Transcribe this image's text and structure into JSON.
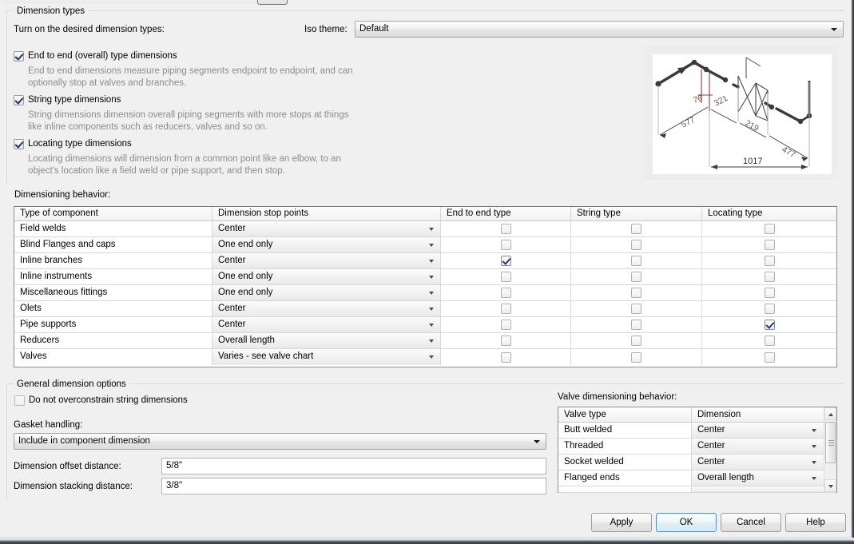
{
  "dimension_types": {
    "group_label": "Dimension types",
    "instruction": "Turn on the desired dimension types:",
    "iso_theme_label": "Iso theme:",
    "iso_theme_value": "Default",
    "options": [
      {
        "label": "End to end (overall) type dimensions",
        "checked": true,
        "description": "End to end dimensions measure piping segments endpoint to endpoint, and can\noptionally stop at valves and branches."
      },
      {
        "label": "String type dimensions",
        "checked": true,
        "description": "String dimensions dimension overall piping segments with more stops at things\nlike inline components such as reducers, valves and so on."
      },
      {
        "label": "Locating type dimensions",
        "checked": true,
        "description": "Locating dimensions will dimension from a common point like an elbow, to an\nobject's location like a field weld or pipe support, and then stop."
      }
    ]
  },
  "preview": {
    "name": "iso-dimension-preview",
    "dimension_labels": [
      "76",
      "321",
      "577",
      "219",
      "1017",
      "477"
    ],
    "accent_color": "#8c3b33"
  },
  "dimensioning_behavior": {
    "label": "Dimensioning behavior:",
    "columns": [
      "Type of component",
      "Dimension stop points",
      "End to end type",
      "String type",
      "Locating type"
    ],
    "rows": [
      {
        "component": "Field welds",
        "stop_point": "Center",
        "end_to_end": false,
        "string": false,
        "locating": false
      },
      {
        "component": "Blind Flanges and caps",
        "stop_point": "One end only",
        "end_to_end": false,
        "string": false,
        "locating": false
      },
      {
        "component": "Inline branches",
        "stop_point": "Center",
        "end_to_end": true,
        "string": false,
        "locating": false
      },
      {
        "component": "Inline instruments",
        "stop_point": "One end only",
        "end_to_end": false,
        "string": false,
        "locating": false
      },
      {
        "component": "Miscellaneous fittings",
        "stop_point": "One end only",
        "end_to_end": false,
        "string": false,
        "locating": false
      },
      {
        "component": "Olets",
        "stop_point": "Center",
        "end_to_end": false,
        "string": false,
        "locating": false
      },
      {
        "component": "Pipe supports",
        "stop_point": "Center",
        "end_to_end": false,
        "string": false,
        "locating": true
      },
      {
        "component": "Reducers",
        "stop_point": "Overall length",
        "end_to_end": false,
        "string": false,
        "locating": false
      },
      {
        "component": "Valves",
        "stop_point": "Varies - see valve chart",
        "end_to_end": false,
        "string": false,
        "locating": false
      }
    ]
  },
  "general_options": {
    "group_label": "General dimension options",
    "overconstrain": {
      "label": "Do not overconstrain string dimensions",
      "checked": false
    },
    "gasket_label": "Gasket handling:",
    "gasket_value": "Include in component dimension",
    "offset_label": "Dimension offset distance:",
    "offset_value": "5/8\"",
    "stacking_label": "Dimension stacking distance:",
    "stacking_value": "3/8\""
  },
  "valve_behavior": {
    "label": "Valve dimensioning behavior:",
    "columns": [
      "Valve type",
      "Dimension"
    ],
    "rows": [
      {
        "valve_type": "Butt welded",
        "dimension": "Center"
      },
      {
        "valve_type": "Threaded",
        "dimension": "Center"
      },
      {
        "valve_type": "Socket welded",
        "dimension": "Center"
      },
      {
        "valve_type": "Flanged ends",
        "dimension": "Overall length"
      }
    ]
  },
  "footer": {
    "apply": "Apply",
    "ok": "OK",
    "cancel": "Cancel",
    "help": "Help"
  }
}
